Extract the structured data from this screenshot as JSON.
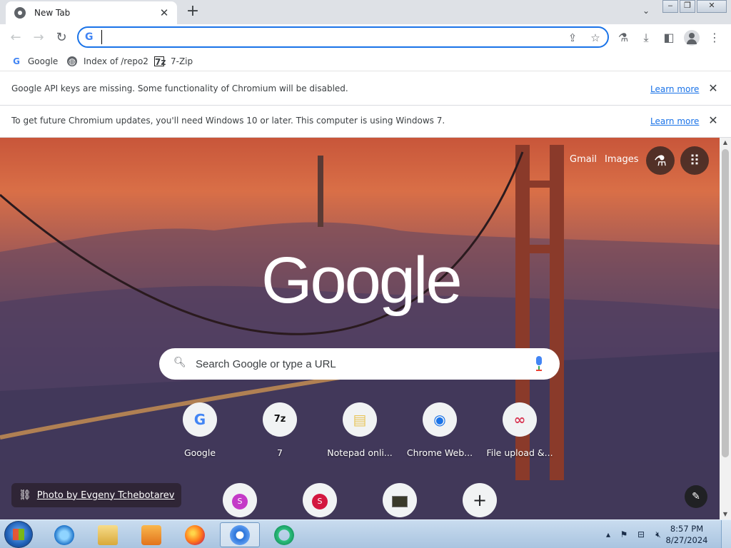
{
  "browser": {
    "tab": {
      "title": "New Tab"
    },
    "omnibox": {
      "value": "",
      "g_letter": "G"
    },
    "bookmarks": [
      {
        "label": "Google",
        "icon": "google-g-icon"
      },
      {
        "label": "Index of /repo2",
        "icon": "globe-icon"
      },
      {
        "label": "7-Zip",
        "icon": "7zip-icon"
      }
    ],
    "infobars": [
      {
        "text": "Google API keys are missing. Some functionality of Chromium will be disabled.",
        "link": "Learn more"
      },
      {
        "text": "To get future Chromium updates, you'll need Windows 10 or later. This computer is using Windows 7.",
        "link": "Learn more"
      }
    ],
    "accent_color": "#1a73e8"
  },
  "ntp": {
    "header_links": {
      "gmail": "Gmail",
      "images": "Images"
    },
    "logo": "Google",
    "search_placeholder": "Search Google or type a URL",
    "shortcuts": [
      {
        "label": "Google",
        "icon": "google-g-icon"
      },
      {
        "label": "7",
        "icon": "7zip-icon"
      },
      {
        "label": "Notepad onli...",
        "icon": "notepad-icon"
      },
      {
        "label": "Chrome Web...",
        "icon": "chrome-web-store-icon"
      },
      {
        "label": "File upload &...",
        "icon": "link-icon"
      },
      {
        "label": "",
        "icon": "s-purple-icon",
        "letter": "S",
        "color": "#c43ac7"
      },
      {
        "label": "",
        "icon": "s-red-icon",
        "letter": "S",
        "color": "#d3173f"
      },
      {
        "label": "",
        "icon": "thumbnail-icon"
      },
      {
        "label": "",
        "icon": "add-shortcut-icon"
      }
    ],
    "attribution": "Photo by Evgeny Tchebotarev"
  },
  "taskbar": {
    "apps": [
      "internet-explorer",
      "file-explorer",
      "media-player",
      "firefox",
      "chromium",
      "opera"
    ],
    "clock": {
      "time": "8:57 PM",
      "date": "8/27/2024"
    }
  }
}
